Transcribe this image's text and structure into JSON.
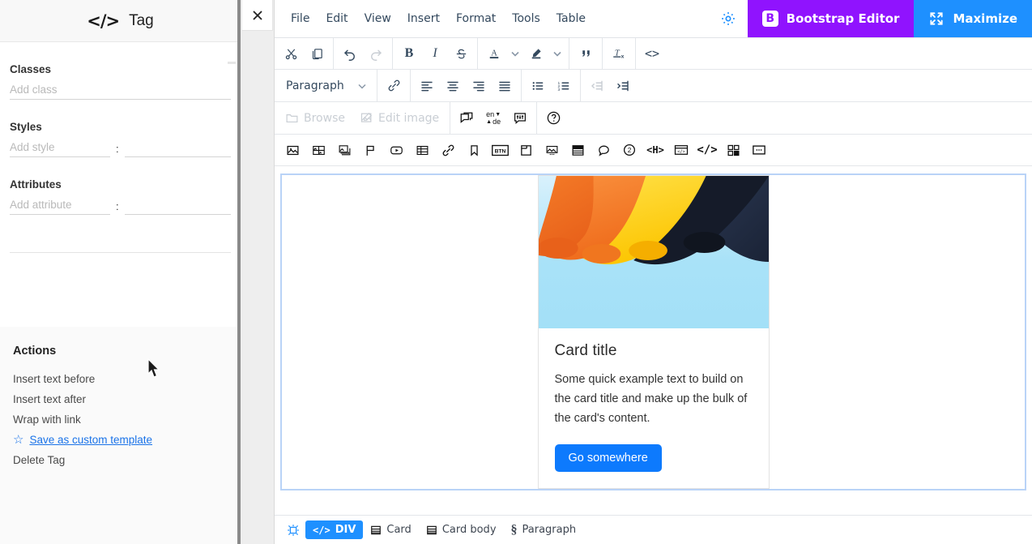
{
  "sidebar": {
    "title": "Tag",
    "code_icon": "</>",
    "close_icon": "close-icon",
    "fields": [
      {
        "label": "Classes",
        "placeholder": "Add class",
        "value": "",
        "type": "single"
      },
      {
        "label": "Styles",
        "key_placeholder": "Add style",
        "key_value": "",
        "separator": ":",
        "val_placeholder": "",
        "val_value": "",
        "type": "pair"
      },
      {
        "label": "Attributes",
        "key_placeholder": "Add attribute",
        "key_value": "",
        "separator": ":",
        "val_placeholder": "",
        "val_value": "",
        "type": "pair"
      }
    ],
    "actions_title": "Actions",
    "actions": [
      {
        "label": "Insert text before",
        "linked": false,
        "icon": ""
      },
      {
        "label": "Insert text after",
        "linked": false,
        "icon": ""
      },
      {
        "label": "Wrap with link",
        "linked": false,
        "icon": ""
      },
      {
        "label": "Save as custom template",
        "linked": true,
        "icon": "star-icon"
      },
      {
        "label": "Delete Tag",
        "linked": false,
        "icon": ""
      }
    ]
  },
  "menubar": {
    "items": [
      "File",
      "Edit",
      "View",
      "Insert",
      "Format",
      "Tools",
      "Table"
    ],
    "gear_icon": "gear-icon",
    "bootstrap_button": "Bootstrap Editor",
    "bootstrap_logo": "B",
    "maximize_button": "Maximize",
    "colors": {
      "bootstrap_purple": "#9013FE",
      "maximize_blue": "#1E90FF",
      "gear_blue": "#1E90FF"
    }
  },
  "toolbar_row1": [
    {
      "name": "cut-icon",
      "title": "Cut",
      "disabled": false
    },
    {
      "name": "copy-icon",
      "title": "Copy",
      "disabled": false
    },
    {
      "name": "undo-icon",
      "title": "Undo",
      "disabled": false
    },
    {
      "name": "redo-icon",
      "title": "Redo",
      "disabled": true
    },
    {
      "name": "bold-icon",
      "title": "Bold",
      "glyph": "B",
      "disabled": false
    },
    {
      "name": "italic-icon",
      "title": "Italic",
      "glyph": "I",
      "disabled": false
    },
    {
      "name": "strikethrough-icon",
      "title": "Strikethrough",
      "glyph": "S",
      "disabled": false
    },
    {
      "name": "text-color-icon",
      "title": "Text color",
      "glyph": "A",
      "disabled": false
    },
    {
      "name": "text-color-chevron-down-icon",
      "title": "Text color options",
      "disabled": false
    },
    {
      "name": "highlight-color-icon",
      "title": "Background color",
      "disabled": false
    },
    {
      "name": "highlight-chevron-down-icon",
      "title": "Background color options",
      "disabled": false
    },
    {
      "name": "blockquote-icon",
      "title": "Blockquote",
      "glyph": "”",
      "disabled": false
    },
    {
      "name": "clear-formatting-icon",
      "title": "Clear formatting",
      "disabled": false
    },
    {
      "name": "source-code-icon",
      "title": "Source code",
      "glyph": "<>",
      "disabled": false
    }
  ],
  "toolbar_row2": {
    "format_select": "Paragraph",
    "buttons": [
      {
        "name": "link-icon",
        "title": "Insert link",
        "disabled": false
      },
      {
        "name": "align-left-icon",
        "title": "Align left",
        "disabled": false
      },
      {
        "name": "align-center-icon",
        "title": "Align center",
        "disabled": false
      },
      {
        "name": "align-right-icon",
        "title": "Align right",
        "disabled": false
      },
      {
        "name": "align-justify-icon",
        "title": "Justify",
        "disabled": false
      },
      {
        "name": "bullet-list-icon",
        "title": "Bullet list",
        "disabled": false
      },
      {
        "name": "numbered-list-icon",
        "title": "Numbered list",
        "disabled": false
      },
      {
        "name": "outdent-icon",
        "title": "Decrease indent",
        "disabled": true
      },
      {
        "name": "indent-icon",
        "title": "Increase indent",
        "disabled": false
      }
    ]
  },
  "toolbar_row3": {
    "browse_label": "Browse",
    "browse_disabled": true,
    "edit_image_label": "Edit image",
    "edit_image_disabled": true,
    "translate_from": "en",
    "translate_to": "de",
    "buttons": [
      {
        "name": "comments-icon",
        "title": "Comments"
      },
      {
        "name": "translate-icon",
        "title": "Translate"
      },
      {
        "name": "settings-panel-icon",
        "title": "Panel settings"
      },
      {
        "name": "help-icon",
        "title": "Help",
        "glyph": "?"
      }
    ]
  },
  "toolbar_row4": [
    {
      "name": "image-icon",
      "title": "Image"
    },
    {
      "name": "image-gallery-icon",
      "title": "Gallery"
    },
    {
      "name": "image-stack-icon",
      "title": "Slider"
    },
    {
      "name": "flag-icon",
      "title": "Flag"
    },
    {
      "name": "video-icon",
      "title": "Video"
    },
    {
      "name": "table-icon",
      "title": "Table"
    },
    {
      "name": "link-chain-icon",
      "title": "Link"
    },
    {
      "name": "bookmark-icon",
      "title": "Bookmark"
    },
    {
      "name": "button-icon",
      "title": "Button",
      "glyph": "BTN"
    },
    {
      "name": "card-icon",
      "title": "Card"
    },
    {
      "name": "carousel-icon",
      "title": "Carousel"
    },
    {
      "name": "accordion-icon",
      "title": "Accordion"
    },
    {
      "name": "tooltip-icon",
      "title": "Tooltip"
    },
    {
      "name": "badge-two-icon",
      "title": "Badge",
      "glyph": "2"
    },
    {
      "name": "heading-icon",
      "title": "Heading",
      "glyph": "<H>"
    },
    {
      "name": "embed-window-icon",
      "title": "Embed"
    },
    {
      "name": "code-tag-icon",
      "title": "Code",
      "glyph": "</>"
    },
    {
      "name": "blocks-grid-icon",
      "title": "Blocks"
    },
    {
      "name": "more-options-icon",
      "title": "More"
    }
  ],
  "canvas": {
    "card": {
      "image_alt": "Colored paper sheets",
      "title": "Card title",
      "text": "Some quick example text to build on the card title and make up the bulk of the card's content.",
      "button_label": "Go somewhere",
      "button_color": "#0d7afd"
    },
    "selection_border_color": "#b9d3f7"
  },
  "statusbar": {
    "target_icon": "crosshair-icon",
    "crumbs": [
      {
        "label": "DIV",
        "icon": "code-tag-icon",
        "active": true
      },
      {
        "label": "Card",
        "icon": "card-icon",
        "active": false
      },
      {
        "label": "Card body",
        "icon": "card-body-icon",
        "active": false
      },
      {
        "label": "Paragraph",
        "icon": "paragraph-icon",
        "active": false
      }
    ]
  }
}
